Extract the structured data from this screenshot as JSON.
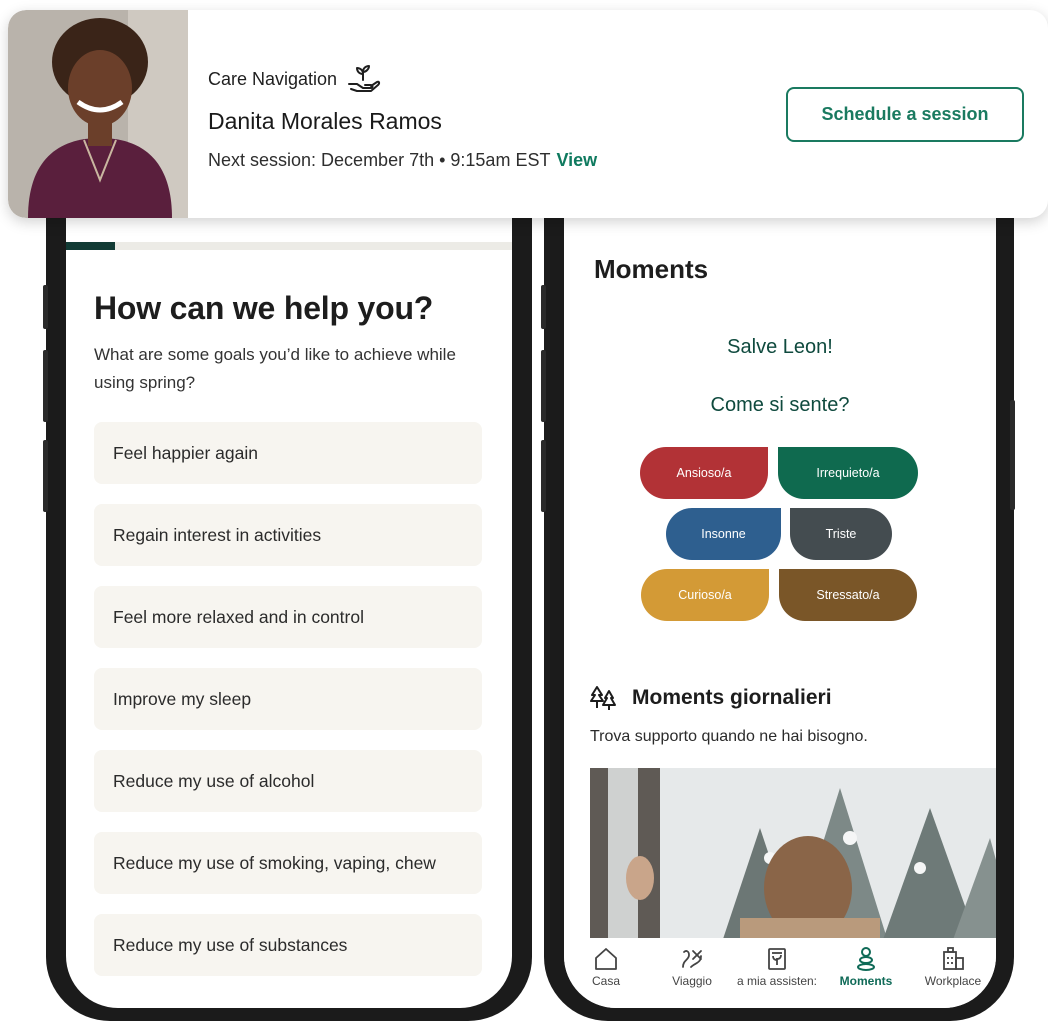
{
  "care_card": {
    "label": "Care Navigation",
    "provider_name": "Danita Morales Ramos",
    "next_session_text": "Next session: December 7th • 9:15am EST",
    "view_link": "View",
    "schedule_button": "Schedule a session"
  },
  "questionnaire": {
    "progress_fraction": 0.11,
    "title": "How can we help you?",
    "subtitle": "What are some goals you’d like to achieve while using spring?",
    "goals": [
      "Feel happier again",
      "Regain interest in activities",
      "Feel more relaxed and in control",
      "Improve my sleep",
      "Reduce my use of alcohol",
      "Reduce my use of smoking, vaping, chew",
      "Reduce my use of substances"
    ]
  },
  "moments": {
    "title": "Moments",
    "greeting": "Salve Leon!",
    "question": "Come si sente?",
    "moods": [
      {
        "label": "Ansioso/a",
        "color": "#b23236"
      },
      {
        "label": "Irrequieto/a",
        "color": "#0f6a4f"
      },
      {
        "label": "Insonne",
        "color": "#2e5f8f"
      },
      {
        "label": "Triste",
        "color": "#444c50"
      },
      {
        "label": "Curioso/a",
        "color": "#d39a36"
      },
      {
        "label": "Stressato/a",
        "color": "#7a5628"
      }
    ],
    "daily_title": "Moments giornalieri",
    "daily_subtitle": "Trova supporto quando ne hai bisogno.",
    "daily_icon": "trees-icon"
  },
  "tabbar": {
    "items": [
      {
        "label": "Casa",
        "icon": "home-icon"
      },
      {
        "label": "Viaggio",
        "icon": "journey-icon"
      },
      {
        "label": "a mia assisten:",
        "icon": "care-doc-icon"
      },
      {
        "label": "Moments",
        "icon": "moments-icon"
      },
      {
        "label": "Workplace",
        "icon": "building-icon"
      }
    ],
    "active": "Moments"
  },
  "colors": {
    "brand_green": "#1a7a60",
    "dark_green": "#0f4a3e",
    "progress": "#123b35",
    "goal_background": "#f7f5f0"
  }
}
